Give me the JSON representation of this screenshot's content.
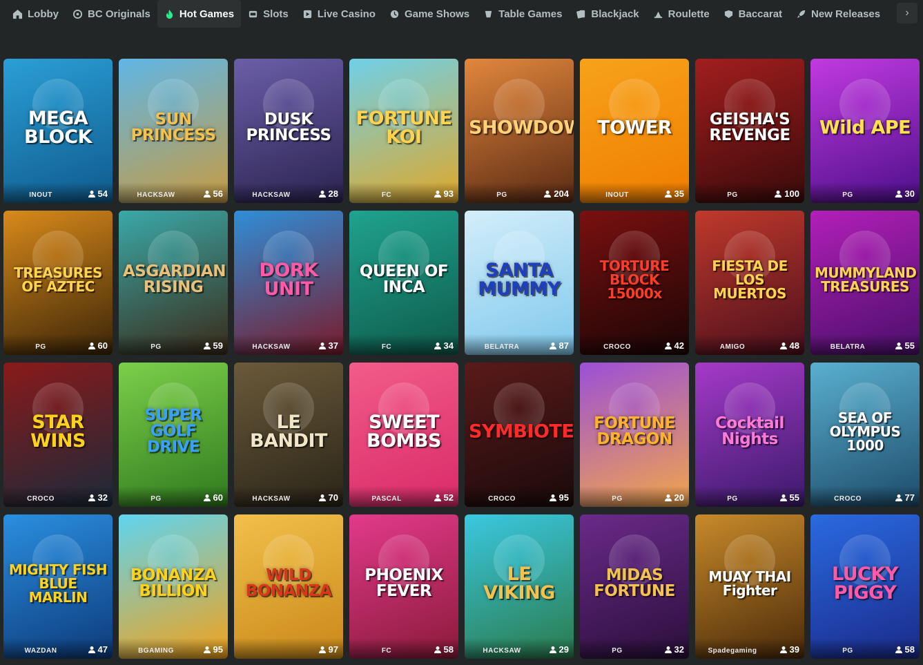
{
  "nav": {
    "tabs": [
      {
        "label": "Lobby",
        "icon": "home-icon",
        "active": false
      },
      {
        "label": "BC Originals",
        "icon": "bc-originals-icon",
        "active": false
      },
      {
        "label": "Hot Games",
        "icon": "flame-icon",
        "active": true
      },
      {
        "label": "Slots",
        "icon": "slot-machine-icon",
        "active": false
      },
      {
        "label": "Live Casino",
        "icon": "live-casino-icon",
        "active": false
      },
      {
        "label": "Game Shows",
        "icon": "game-show-icon",
        "active": false
      },
      {
        "label": "Table Games",
        "icon": "table-games-icon",
        "active": false
      },
      {
        "label": "Blackjack",
        "icon": "cards-icon",
        "active": false
      },
      {
        "label": "Roulette",
        "icon": "roulette-icon",
        "active": false
      },
      {
        "label": "Baccarat",
        "icon": "baccarat-icon",
        "active": false
      },
      {
        "label": "New Releases",
        "icon": "rocket-icon",
        "active": false
      }
    ],
    "more_icon": "chevron-right-icon"
  },
  "games": [
    {
      "title": "MEGA BLOCK",
      "provider": "INOUT",
      "players": "54",
      "colors": [
        "#2a9fd6",
        "#0f5a8c"
      ],
      "title_color": "#ffffff"
    },
    {
      "title": "SUN PRINCESS",
      "provider": "HACKSAW",
      "players": "56",
      "colors": [
        "#5fb6e6",
        "#c79b42"
      ],
      "title_color": "#f2c14e"
    },
    {
      "title": "DUSK PRINCESS",
      "provider": "HACKSAW",
      "players": "28",
      "colors": [
        "#6b5ea8",
        "#2b2350"
      ],
      "title_color": "#ffffff"
    },
    {
      "title": "FORTUNE KOI",
      "provider": "FC",
      "players": "93",
      "colors": [
        "#6fd0e8",
        "#e0a82a"
      ],
      "title_color": "#ffd34d"
    },
    {
      "title": "SHOWDOWN",
      "provider": "PG",
      "players": "204",
      "colors": [
        "#e2873c",
        "#5a2a14"
      ],
      "title_color": "#ffd27a"
    },
    {
      "title": "TOWER",
      "provider": "INOUT",
      "players": "35",
      "colors": [
        "#f7a21b",
        "#f07d00"
      ],
      "title_color": "#ffffff"
    },
    {
      "title": "GEISHA'S REVENGE",
      "provider": "PG",
      "players": "100",
      "colors": [
        "#a21e1e",
        "#3a0a0a"
      ],
      "title_color": "#ffffff"
    },
    {
      "title": "Wild APE",
      "provider": "PG",
      "players": "30",
      "colors": [
        "#c13ae0",
        "#4d0f8a"
      ],
      "title_color": "#ffe14d"
    },
    {
      "title": "TREASURES OF AZTEC",
      "provider": "PG",
      "players": "60",
      "colors": [
        "#d98a1a",
        "#3b2508"
      ],
      "title_color": "#ffd34d"
    },
    {
      "title": "ASGARDIAN RISING",
      "provider": "PG",
      "players": "59",
      "colors": [
        "#3aa9a8",
        "#3a2a18"
      ],
      "title_color": "#e8c07a"
    },
    {
      "title": "DORK UNIT",
      "provider": "HACKSAW",
      "players": "37",
      "colors": [
        "#2f8ed8",
        "#7a1a2a"
      ],
      "title_color": "#ff5aa8"
    },
    {
      "title": "QUEEN OF INCA",
      "provider": "FC",
      "players": "34",
      "colors": [
        "#1fa38f",
        "#0e5a4a"
      ],
      "title_color": "#ffffff"
    },
    {
      "title": "SANTA MUMMY",
      "provider": "BELATRA",
      "players": "87",
      "colors": [
        "#d3eefa",
        "#7fc8ec"
      ],
      "title_color": "#1e3fbf"
    },
    {
      "title": "TORTURE BLOCK 15000x",
      "provider": "CROCO",
      "players": "42",
      "colors": [
        "#7a1010",
        "#1a0505"
      ],
      "title_color": "#ff3b2a"
    },
    {
      "title": "FIESTA DE LOS MUERTOS",
      "provider": "AMIGO",
      "players": "48",
      "colors": [
        "#c0392b",
        "#4a0f1c"
      ],
      "title_color": "#ffd34d"
    },
    {
      "title": "MUMMYLAND TREASURES",
      "provider": "BELATRA",
      "players": "55",
      "colors": [
        "#b21fb8",
        "#4a0f6a"
      ],
      "title_color": "#ffd34d"
    },
    {
      "title": "STAR WINS",
      "provider": "CROCO",
      "players": "32",
      "colors": [
        "#8a1a1a",
        "#1b2a3a"
      ],
      "title_color": "#ffd21a"
    },
    {
      "title": "SUPER GOLF DRIVE",
      "provider": "PG",
      "players": "60",
      "colors": [
        "#7ccf4a",
        "#2f7a1e"
      ],
      "title_color": "#3aa0ff"
    },
    {
      "title": "LE BANDIT",
      "provider": "HACKSAW",
      "players": "70",
      "colors": [
        "#6b5a3a",
        "#2a2418"
      ],
      "title_color": "#f2e6c8"
    },
    {
      "title": "SWEET BOMBS",
      "provider": "PASCAL",
      "players": "52",
      "colors": [
        "#f25c8a",
        "#d92a68"
      ],
      "title_color": "#ffffff"
    },
    {
      "title": "SYMBIOTE",
      "provider": "CROCO",
      "players": "95",
      "colors": [
        "#5a1a1a",
        "#1a0a0a"
      ],
      "title_color": "#ff2a2a"
    },
    {
      "title": "FORTUNE DRAGON",
      "provider": "PG",
      "players": "20",
      "colors": [
        "#9b4fd8",
        "#f2a64a"
      ],
      "title_color": "#ffb32a"
    },
    {
      "title": "Cocktail Nights",
      "provider": "PG",
      "players": "55",
      "colors": [
        "#a53ac8",
        "#3a1a6a"
      ],
      "title_color": "#ff7ad8"
    },
    {
      "title": "SEA OF OLYMPUS 1000",
      "provider": "CROCO",
      "players": "77",
      "colors": [
        "#5ab0d0",
        "#1d4a6a"
      ],
      "title_color": "#ffffff"
    },
    {
      "title": "MIGHTY FISH BLUE MARLIN",
      "provider": "WAZDAN",
      "players": "47",
      "colors": [
        "#2a8fe0",
        "#0d3a7a"
      ],
      "title_color": "#ffd21a"
    },
    {
      "title": "BONANZA BILLION",
      "provider": "BGAMING",
      "players": "95",
      "colors": [
        "#5fd4f0",
        "#f2a21a"
      ],
      "title_color": "#ffd21a"
    },
    {
      "title": "WILD BONANZA",
      "provider": "",
      "players": "97",
      "colors": [
        "#f2c04a",
        "#c9881a"
      ],
      "title_color": "#d9361a"
    },
    {
      "title": "PHOENIX FEVER",
      "provider": "FC",
      "players": "58",
      "colors": [
        "#e23a8a",
        "#8a1a3a"
      ],
      "title_color": "#ffffff"
    },
    {
      "title": "LE VIKING",
      "provider": "HACKSAW",
      "players": "29",
      "colors": [
        "#3ac8e0",
        "#2a7a4a"
      ],
      "title_color": "#f2c14e"
    },
    {
      "title": "MIDAS FORTUNE",
      "provider": "PG",
      "players": "32",
      "colors": [
        "#6a2a8a",
        "#2a0f3a"
      ],
      "title_color": "#f2c14e"
    },
    {
      "title": "MUAY THAI Fighter",
      "provider": "Spadegaming",
      "players": "39",
      "colors": [
        "#c88a2a",
        "#4a2a0a"
      ],
      "title_color": "#ffffff"
    },
    {
      "title": "LUCKY PIGGY",
      "provider": "PG",
      "players": "58",
      "colors": [
        "#2a6ae0",
        "#1a2a8a"
      ],
      "title_color": "#ff5aa8"
    }
  ]
}
